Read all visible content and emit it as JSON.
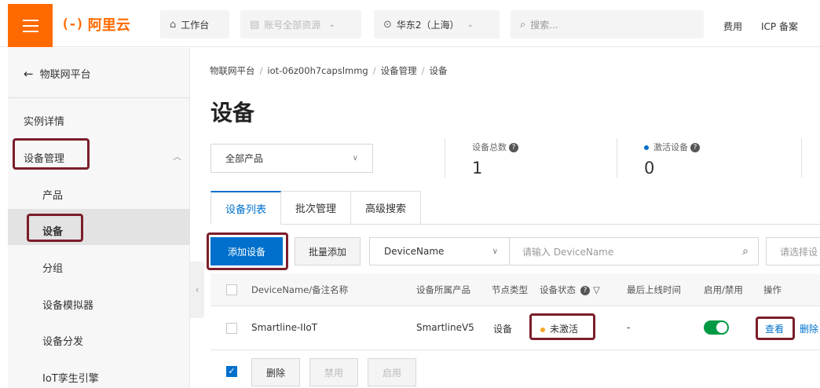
{
  "topbar": {
    "logo_mark": "(-)",
    "logo_text": "阿里云",
    "workbench": "工作台",
    "resources": "账号全部资源",
    "region": "华东2（上海）",
    "search_placeholder": "搜索...",
    "fees": "费用",
    "icp": "ICP 备案"
  },
  "sidebar": {
    "back_label": "物联网平台",
    "items": [
      {
        "label": "实例详情"
      },
      {
        "label": "设备管理"
      },
      {
        "label": "产品"
      },
      {
        "label": "设备"
      },
      {
        "label": "分组"
      },
      {
        "label": "设备模拟器"
      },
      {
        "label": "设备分发"
      },
      {
        "label": "IoT孪生引擎"
      }
    ]
  },
  "breadcrumb": [
    "物联网平台",
    "iot-06z00h7capslmmg",
    "设备管理",
    "设备"
  ],
  "page_title": "设备",
  "product_select": "全部产品",
  "stats": {
    "total_label": "设备总数",
    "total_value": "1",
    "active_label": "激活设备",
    "active_value": "0"
  },
  "tabs": [
    "设备列表",
    "批次管理",
    "高级搜索"
  ],
  "toolbar": {
    "add_device": "添加设备",
    "batch_add": "批量添加",
    "field": "DeviceName",
    "search_placeholder": "请输入 DeviceName",
    "filter_placeholder": "请选择设"
  },
  "table": {
    "headers": {
      "name": "DeviceName/备注名称",
      "product": "设备所属产品",
      "node_type": "节点类型",
      "status": "设备状态",
      "last_online": "最后上线时间",
      "enable": "启用/禁用",
      "actions": "操作"
    },
    "rows": [
      {
        "name": "Smartline-IIoT",
        "product": "SmartlineV5",
        "node_type": "设备",
        "status": "未激活",
        "last_online": "-",
        "enabled": true,
        "view": "查看",
        "delete": "删除"
      }
    ]
  },
  "footer": {
    "delete": "删除",
    "disable": "禁用",
    "enable": "启用"
  },
  "colors": {
    "brand": "#ff6a00",
    "primary": "#0070cc",
    "highlight_border": "#7b1e2b",
    "toggle_on": "#009944",
    "inactive_dot": "#f5a623"
  }
}
